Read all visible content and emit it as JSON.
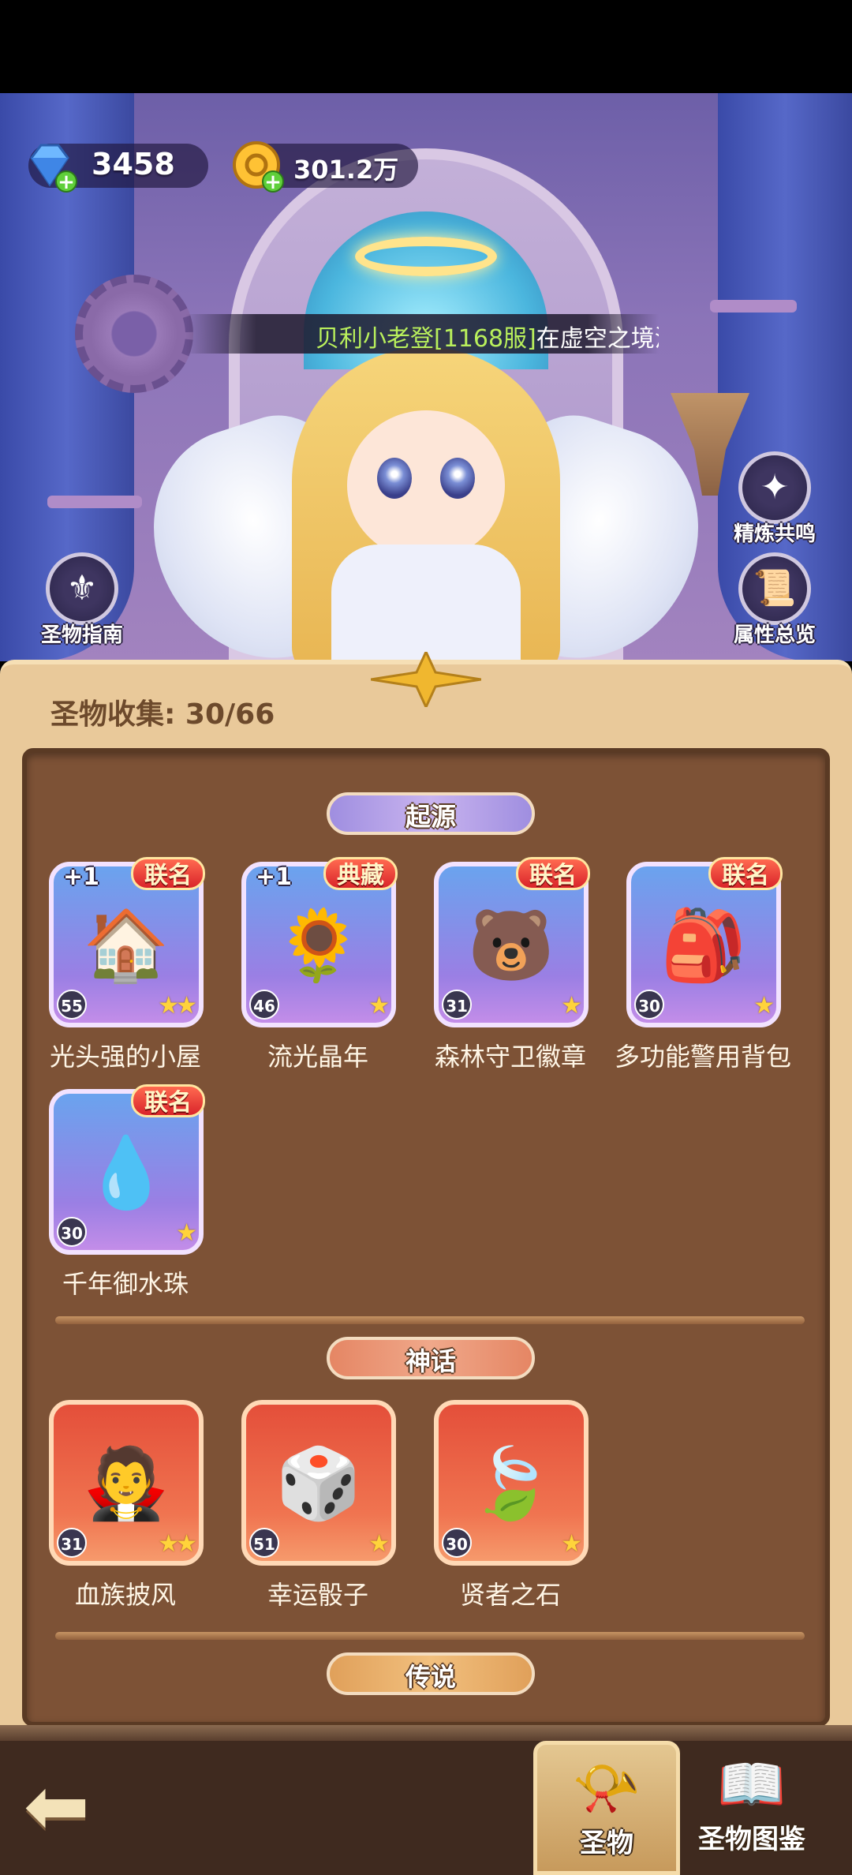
{
  "resources": {
    "diamonds": {
      "value": "3458",
      "icon": "diamond-icon"
    },
    "gold": {
      "value": "301.2万",
      "icon": "gold-coin-icon"
    }
  },
  "broadcast": {
    "player": "贝利小老登[1168服]",
    "message": "在虚空之境湛"
  },
  "side_buttons": {
    "guide": "圣物指南",
    "resonance": "精炼共鸣",
    "attributes": "属性总览"
  },
  "collection": {
    "label": "圣物收集: 30/66"
  },
  "categories": {
    "origin": "起源",
    "myth": "神话",
    "legend": "传说"
  },
  "origin_items": [
    {
      "name": "光头强的小屋",
      "level": "55",
      "tag": "联名",
      "plus": "+1",
      "stars": "★★",
      "icon": "🏠"
    },
    {
      "name": "流光晶年",
      "level": "46",
      "tag": "典藏",
      "plus": "+1",
      "stars": "★",
      "icon": "🌻"
    },
    {
      "name": "森林守卫徽章",
      "level": "31",
      "tag": "联名",
      "plus": "",
      "stars": "★",
      "icon": "🐻"
    },
    {
      "name": "多功能警用背包",
      "level": "30",
      "tag": "联名",
      "plus": "",
      "stars": "★",
      "icon": "🎒"
    },
    {
      "name": "千年御水珠",
      "level": "30",
      "tag": "联名",
      "plus": "",
      "stars": "★",
      "icon": "💧"
    }
  ],
  "myth_items": [
    {
      "name": "血族披风",
      "level": "31",
      "stars": "★★",
      "icon": "🧛"
    },
    {
      "name": "幸运骰子",
      "level": "51",
      "stars": "★",
      "icon": "🎲"
    },
    {
      "name": "贤者之石",
      "level": "30",
      "stars": "★",
      "icon": "🍃"
    }
  ],
  "bottom_nav": {
    "back_icon": "back-arrow-icon",
    "relic": "圣物",
    "codex": "圣物图鉴"
  }
}
